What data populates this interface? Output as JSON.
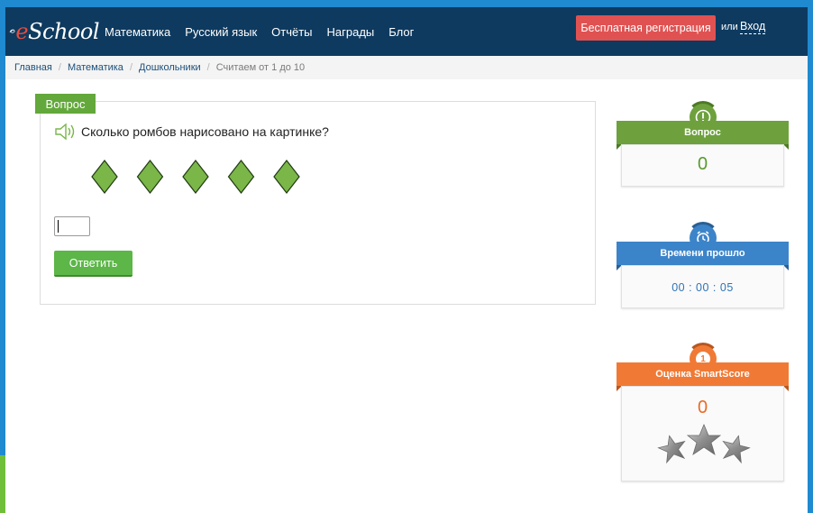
{
  "navbar": {
    "logo_text": "eSchool",
    "links": [
      "Математика",
      "Русский язык",
      "Отчёты",
      "Награды",
      "Блог"
    ],
    "register_label": "Бесплатная регистрация",
    "or_label": "или",
    "login_label": "Вход"
  },
  "breadcrumb": {
    "items": [
      "Главная",
      "Математика",
      "Дошкольники"
    ],
    "current": "Считаем от 1 до 10",
    "separator": "/"
  },
  "question": {
    "tab_label": "Вопрос",
    "text": "Сколько ромбов нарисовано на картинке?",
    "diamond_count": 5,
    "diamond_color": "#7ab648",
    "answer_value": "",
    "submit_label": "Ответить"
  },
  "widgets": {
    "questions": {
      "title": "Вопрос",
      "value": "0",
      "icon": "exclamation-icon",
      "color": "#6ea13d"
    },
    "time": {
      "title": "Времени прошло",
      "value": "00 : 00 : 05",
      "icon": "alarm-clock-icon",
      "color": "#3c84c9"
    },
    "smartscore": {
      "title": "Оценка SmartScore",
      "value": "0",
      "badge": "1",
      "icon": "stars-icon",
      "color": "#f07a35"
    }
  },
  "colors": {
    "navbar_bg": "#0e3a5f",
    "register_bg": "#e05252",
    "frame": "#1f8ad0",
    "submit_bg": "#5cb648"
  }
}
